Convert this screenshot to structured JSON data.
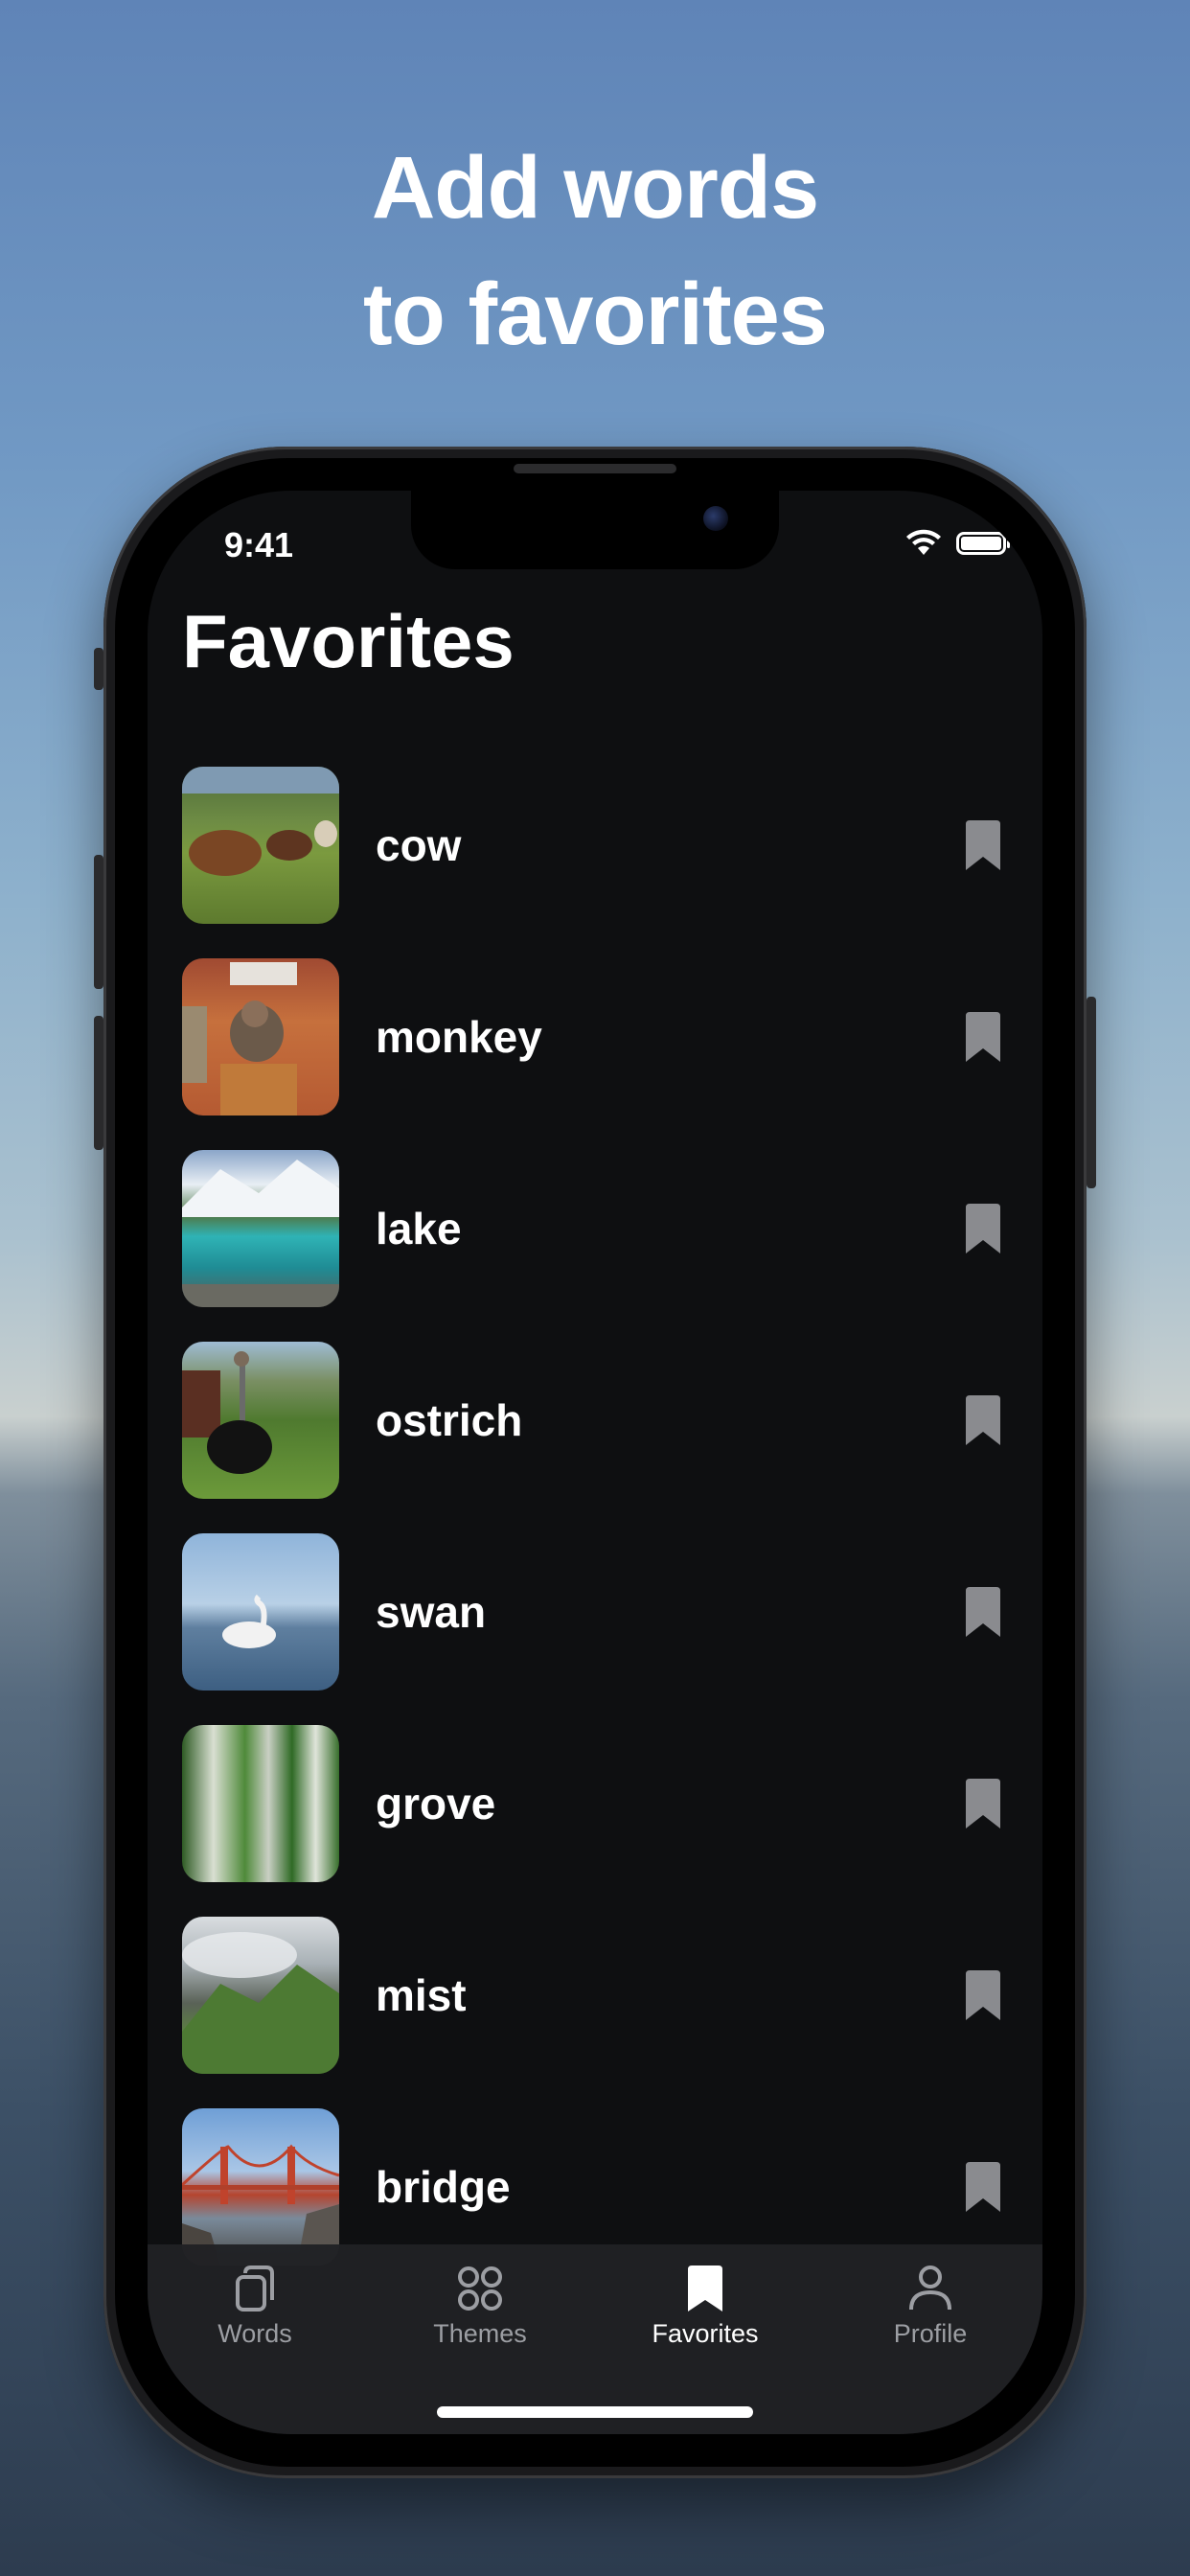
{
  "headline": {
    "line1": "Add words",
    "line2": "to favorites"
  },
  "status_bar": {
    "time": "9:41"
  },
  "screen": {
    "title": "Favorites"
  },
  "favorites": [
    {
      "word": "cow",
      "thumb": "cow-photo"
    },
    {
      "word": "monkey",
      "thumb": "monkey-photo"
    },
    {
      "word": "lake",
      "thumb": "lake-photo"
    },
    {
      "word": "ostrich",
      "thumb": "ostrich-photo"
    },
    {
      "word": "swan",
      "thumb": "swan-photo"
    },
    {
      "word": "grove",
      "thumb": "grove-photo"
    },
    {
      "word": "mist",
      "thumb": "mist-photo"
    },
    {
      "word": "bridge",
      "thumb": "bridge-photo"
    }
  ],
  "tabbar": {
    "tabs": [
      {
        "label": "Words",
        "icon": "cards-icon"
      },
      {
        "label": "Themes",
        "icon": "grid-icon"
      },
      {
        "label": "Favorites",
        "icon": "bookmark-icon",
        "active": true
      },
      {
        "label": "Profile",
        "icon": "person-icon"
      }
    ]
  },
  "colors": {
    "screen_bg": "#0e0f11",
    "bookmark_gray": "#8a8b8f",
    "tab_inactive": "#9c9ea3",
    "tab_active": "#ffffff"
  }
}
